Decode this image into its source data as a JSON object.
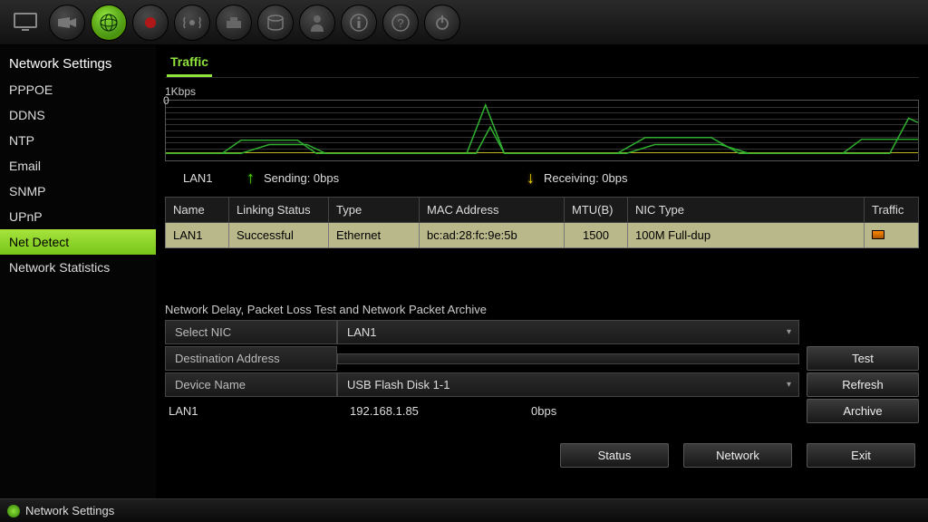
{
  "sidebar": {
    "header": "Network Settings",
    "items": [
      "PPPOE",
      "DDNS",
      "NTP",
      "Email",
      "SNMP",
      "UPnP",
      "Net Detect",
      "Network Statistics"
    ],
    "active_index": 6
  },
  "tab": {
    "label": "Traffic"
  },
  "graph": {
    "ylabel": "1Kbps",
    "zero": "0"
  },
  "legend": {
    "lan": "LAN1",
    "sending": "Sending: 0bps",
    "receiving": "Receiving: 0bps"
  },
  "table": {
    "headers": [
      "Name",
      "Linking Status",
      "Type",
      "MAC Address",
      "MTU(B)",
      "NIC Type",
      "Traffic"
    ],
    "row": {
      "name": "LAN1",
      "status": "Successful",
      "type": "Ethernet",
      "mac": "bc:ad:28:fc:9e:5b",
      "mtu": "1500",
      "nic": "100M Full-dup"
    }
  },
  "section": {
    "title": "Network Delay, Packet Loss Test and Network Packet Archive"
  },
  "form": {
    "select_nic_label": "Select NIC",
    "select_nic_value": "LAN1",
    "dest_label": "Destination Address",
    "dest_value": "",
    "device_label": "Device Name",
    "device_value": "USB Flash Disk 1-1"
  },
  "buttons": {
    "test": "Test",
    "refresh": "Refresh",
    "archive": "Archive",
    "status": "Status",
    "network": "Network",
    "exit": "Exit"
  },
  "inforow": {
    "lan": "LAN1",
    "ip": "192.168.1.85",
    "rate": "0bps"
  },
  "statusbar": {
    "context": "Network Settings"
  }
}
